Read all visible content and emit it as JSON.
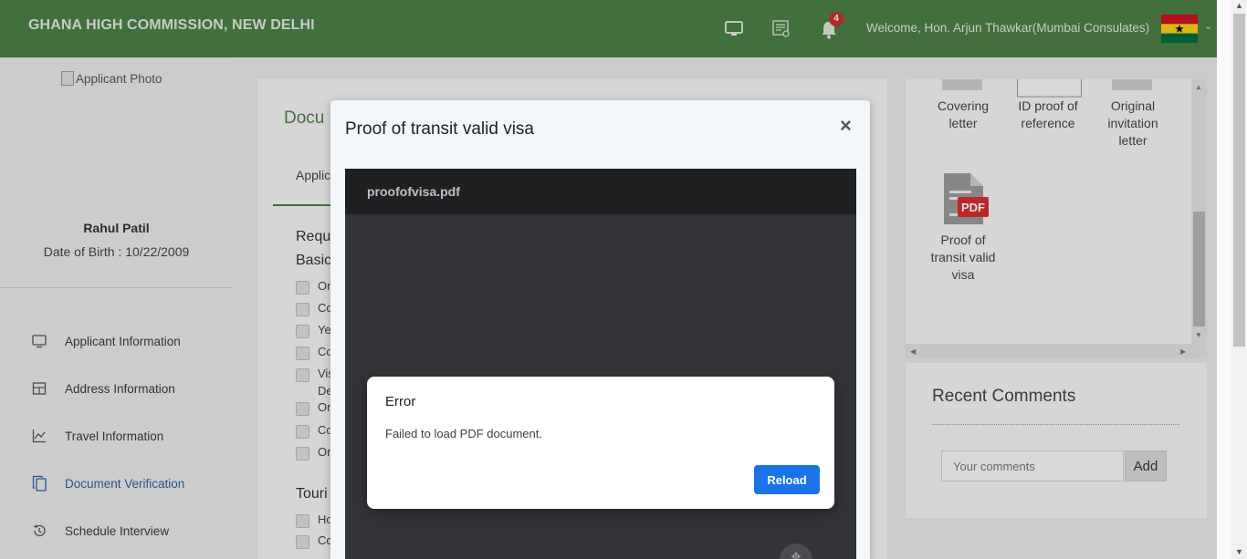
{
  "header": {
    "brand": "GHANA HIGH COMMISSION, NEW DELHI",
    "notification_count": "4",
    "welcome": "Welcome, Hon. Arjun Thawkar(Mumbai Consulates)",
    "icons": [
      "monitor-icon",
      "certificate-icon",
      "bell-icon"
    ],
    "color": "#4d7e47"
  },
  "sidebar": {
    "photo_alt": "Applicant Photo",
    "applicant_name": "Rahul Patil",
    "dob": "Date of Birth : 10/22/2009",
    "items": [
      {
        "label": "Applicant Information",
        "icon": "monitor-icon"
      },
      {
        "label": "Address Information",
        "icon": "grid-icon"
      },
      {
        "label": "Travel Information",
        "icon": "line-chart-icon"
      },
      {
        "label": "Document Verification",
        "icon": "copy-icon",
        "active": true
      },
      {
        "label": "Schedule Interview",
        "icon": "history-icon"
      }
    ]
  },
  "main": {
    "title_partial": "Docu",
    "tab_partial": "Applic",
    "heading1_partial": "Requ",
    "heading2_partial": "Basic",
    "checklist_partial": [
      "Or",
      "Co",
      "Ye",
      "Co",
      "Vis",
      "De",
      "Or",
      "Co",
      "Or"
    ],
    "heading3_partial": "Touri",
    "checklist2_partial": [
      "Ho",
      "Co"
    ]
  },
  "documents": {
    "items": [
      "Covering letter",
      "ID proof of reference",
      "Original invitation letter",
      "Proof of transit valid visa"
    ],
    "pdf_badge": "PDF"
  },
  "comments": {
    "title": "Recent Comments",
    "placeholder": "Your comments",
    "add_label": "Add"
  },
  "modal": {
    "title": "Proof of transit valid visa",
    "close": "×",
    "file_name": "proofofvisa.pdf",
    "error": {
      "title": "Error",
      "message": "Failed to load PDF document.",
      "reload_label": "Reload",
      "accent": "#1a73e8"
    }
  }
}
